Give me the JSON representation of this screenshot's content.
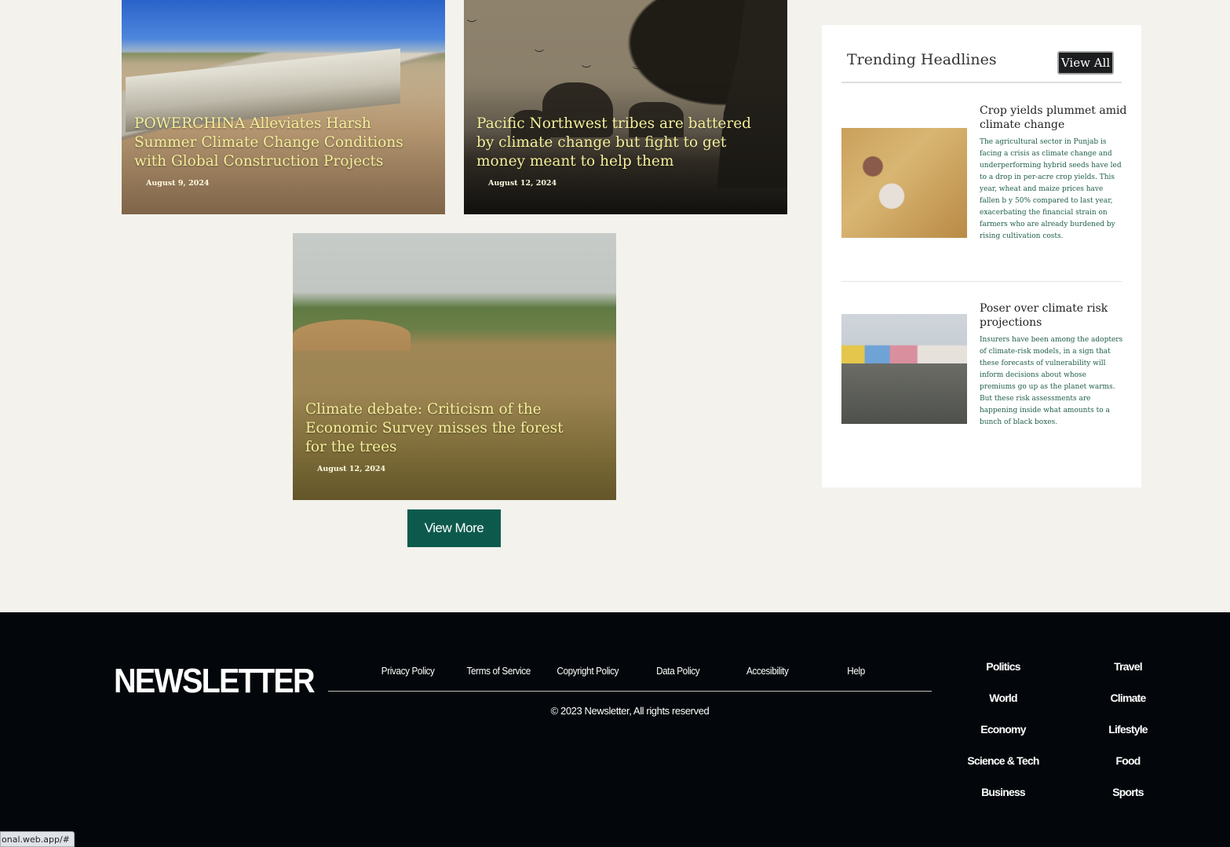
{
  "articles": [
    {
      "title": "POWERCHINA Alleviates Harsh Summer Climate Change Conditions with Global Construction Projects",
      "date": "August 9, 2024"
    },
    {
      "title": "Pacific Northwest tribes are battered by climate change but fight to get money meant to help them",
      "date": "August 12, 2024"
    },
    {
      "title": "Climate debate: Criticism of the Economic Survey misses the forest for the trees",
      "date": "August 12, 2024"
    }
  ],
  "view_more_label": "View More",
  "trending": {
    "title": "Trending Headlines",
    "view_all_label": "View All",
    "items": [
      {
        "headline": "Crop yields plummet amid climate change",
        "summary": "The agricultural sector in Punjab is facing a crisis as climate change and underperforming hybrid seeds have led to a drop in per-acre crop yields. This year, wheat and maize prices have fallen b y 50% compared to last year, exacerbating the financial strain on farmers who are already burdened by rising cultivation costs."
      },
      {
        "headline": "Poser over climate risk projections",
        "summary": "Insurers have been among the adopters of climate-risk models, in a sign that these forecasts of vulnerability will inform decisions about whose premiums go up as the planet warms. But these risk assessments are happening inside what amounts to a bunch of black boxes."
      }
    ]
  },
  "footer": {
    "brand": "NEWSLETTER",
    "links": [
      "Privacy Policy",
      "Terms of Service",
      "Copyright Policy",
      "Data Policy",
      "Accesibility",
      "Help"
    ],
    "copyright": "© 2023 Newsletter, All rights reserved",
    "categories_left": [
      "Politics",
      "World",
      "Economy",
      "Science & Tech",
      "Business"
    ],
    "categories_right": [
      "Travel",
      "Climate",
      "Lifestyle",
      "Food",
      "Sports"
    ]
  },
  "status_url": "onal.web.app/#",
  "colors": {
    "accent_green": "#0d5a4d",
    "footer_bg": "#03070b",
    "headline_yellow": "#f4ef9a",
    "page_bg": "#f3f2ec"
  }
}
